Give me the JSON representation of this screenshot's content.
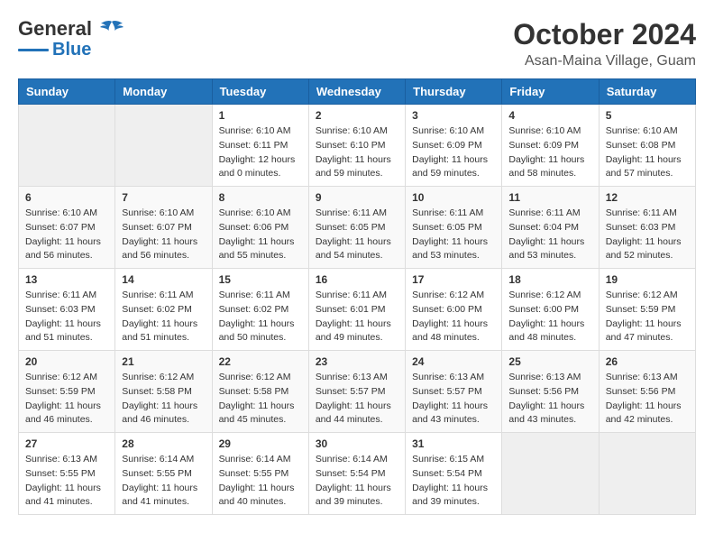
{
  "header": {
    "logo_line1": "General",
    "logo_line2": "Blue",
    "month": "October 2024",
    "location": "Asan-Maina Village, Guam"
  },
  "calendar": {
    "days_of_week": [
      "Sunday",
      "Monday",
      "Tuesday",
      "Wednesday",
      "Thursday",
      "Friday",
      "Saturday"
    ],
    "weeks": [
      [
        {
          "day": "",
          "sunrise": "",
          "sunset": "",
          "daylight": ""
        },
        {
          "day": "",
          "sunrise": "",
          "sunset": "",
          "daylight": ""
        },
        {
          "day": "1",
          "sunrise": "Sunrise: 6:10 AM",
          "sunset": "Sunset: 6:11 PM",
          "daylight": "Daylight: 12 hours and 0 minutes."
        },
        {
          "day": "2",
          "sunrise": "Sunrise: 6:10 AM",
          "sunset": "Sunset: 6:10 PM",
          "daylight": "Daylight: 11 hours and 59 minutes."
        },
        {
          "day": "3",
          "sunrise": "Sunrise: 6:10 AM",
          "sunset": "Sunset: 6:09 PM",
          "daylight": "Daylight: 11 hours and 59 minutes."
        },
        {
          "day": "4",
          "sunrise": "Sunrise: 6:10 AM",
          "sunset": "Sunset: 6:09 PM",
          "daylight": "Daylight: 11 hours and 58 minutes."
        },
        {
          "day": "5",
          "sunrise": "Sunrise: 6:10 AM",
          "sunset": "Sunset: 6:08 PM",
          "daylight": "Daylight: 11 hours and 57 minutes."
        }
      ],
      [
        {
          "day": "6",
          "sunrise": "Sunrise: 6:10 AM",
          "sunset": "Sunset: 6:07 PM",
          "daylight": "Daylight: 11 hours and 56 minutes."
        },
        {
          "day": "7",
          "sunrise": "Sunrise: 6:10 AM",
          "sunset": "Sunset: 6:07 PM",
          "daylight": "Daylight: 11 hours and 56 minutes."
        },
        {
          "day": "8",
          "sunrise": "Sunrise: 6:10 AM",
          "sunset": "Sunset: 6:06 PM",
          "daylight": "Daylight: 11 hours and 55 minutes."
        },
        {
          "day": "9",
          "sunrise": "Sunrise: 6:11 AM",
          "sunset": "Sunset: 6:05 PM",
          "daylight": "Daylight: 11 hours and 54 minutes."
        },
        {
          "day": "10",
          "sunrise": "Sunrise: 6:11 AM",
          "sunset": "Sunset: 6:05 PM",
          "daylight": "Daylight: 11 hours and 53 minutes."
        },
        {
          "day": "11",
          "sunrise": "Sunrise: 6:11 AM",
          "sunset": "Sunset: 6:04 PM",
          "daylight": "Daylight: 11 hours and 53 minutes."
        },
        {
          "day": "12",
          "sunrise": "Sunrise: 6:11 AM",
          "sunset": "Sunset: 6:03 PM",
          "daylight": "Daylight: 11 hours and 52 minutes."
        }
      ],
      [
        {
          "day": "13",
          "sunrise": "Sunrise: 6:11 AM",
          "sunset": "Sunset: 6:03 PM",
          "daylight": "Daylight: 11 hours and 51 minutes."
        },
        {
          "day": "14",
          "sunrise": "Sunrise: 6:11 AM",
          "sunset": "Sunset: 6:02 PM",
          "daylight": "Daylight: 11 hours and 51 minutes."
        },
        {
          "day": "15",
          "sunrise": "Sunrise: 6:11 AM",
          "sunset": "Sunset: 6:02 PM",
          "daylight": "Daylight: 11 hours and 50 minutes."
        },
        {
          "day": "16",
          "sunrise": "Sunrise: 6:11 AM",
          "sunset": "Sunset: 6:01 PM",
          "daylight": "Daylight: 11 hours and 49 minutes."
        },
        {
          "day": "17",
          "sunrise": "Sunrise: 6:12 AM",
          "sunset": "Sunset: 6:00 PM",
          "daylight": "Daylight: 11 hours and 48 minutes."
        },
        {
          "day": "18",
          "sunrise": "Sunrise: 6:12 AM",
          "sunset": "Sunset: 6:00 PM",
          "daylight": "Daylight: 11 hours and 48 minutes."
        },
        {
          "day": "19",
          "sunrise": "Sunrise: 6:12 AM",
          "sunset": "Sunset: 5:59 PM",
          "daylight": "Daylight: 11 hours and 47 minutes."
        }
      ],
      [
        {
          "day": "20",
          "sunrise": "Sunrise: 6:12 AM",
          "sunset": "Sunset: 5:59 PM",
          "daylight": "Daylight: 11 hours and 46 minutes."
        },
        {
          "day": "21",
          "sunrise": "Sunrise: 6:12 AM",
          "sunset": "Sunset: 5:58 PM",
          "daylight": "Daylight: 11 hours and 46 minutes."
        },
        {
          "day": "22",
          "sunrise": "Sunrise: 6:12 AM",
          "sunset": "Sunset: 5:58 PM",
          "daylight": "Daylight: 11 hours and 45 minutes."
        },
        {
          "day": "23",
          "sunrise": "Sunrise: 6:13 AM",
          "sunset": "Sunset: 5:57 PM",
          "daylight": "Daylight: 11 hours and 44 minutes."
        },
        {
          "day": "24",
          "sunrise": "Sunrise: 6:13 AM",
          "sunset": "Sunset: 5:57 PM",
          "daylight": "Daylight: 11 hours and 43 minutes."
        },
        {
          "day": "25",
          "sunrise": "Sunrise: 6:13 AM",
          "sunset": "Sunset: 5:56 PM",
          "daylight": "Daylight: 11 hours and 43 minutes."
        },
        {
          "day": "26",
          "sunrise": "Sunrise: 6:13 AM",
          "sunset": "Sunset: 5:56 PM",
          "daylight": "Daylight: 11 hours and 42 minutes."
        }
      ],
      [
        {
          "day": "27",
          "sunrise": "Sunrise: 6:13 AM",
          "sunset": "Sunset: 5:55 PM",
          "daylight": "Daylight: 11 hours and 41 minutes."
        },
        {
          "day": "28",
          "sunrise": "Sunrise: 6:14 AM",
          "sunset": "Sunset: 5:55 PM",
          "daylight": "Daylight: 11 hours and 41 minutes."
        },
        {
          "day": "29",
          "sunrise": "Sunrise: 6:14 AM",
          "sunset": "Sunset: 5:55 PM",
          "daylight": "Daylight: 11 hours and 40 minutes."
        },
        {
          "day": "30",
          "sunrise": "Sunrise: 6:14 AM",
          "sunset": "Sunset: 5:54 PM",
          "daylight": "Daylight: 11 hours and 39 minutes."
        },
        {
          "day": "31",
          "sunrise": "Sunrise: 6:15 AM",
          "sunset": "Sunset: 5:54 PM",
          "daylight": "Daylight: 11 hours and 39 minutes."
        },
        {
          "day": "",
          "sunrise": "",
          "sunset": "",
          "daylight": ""
        },
        {
          "day": "",
          "sunrise": "",
          "sunset": "",
          "daylight": ""
        }
      ]
    ]
  }
}
